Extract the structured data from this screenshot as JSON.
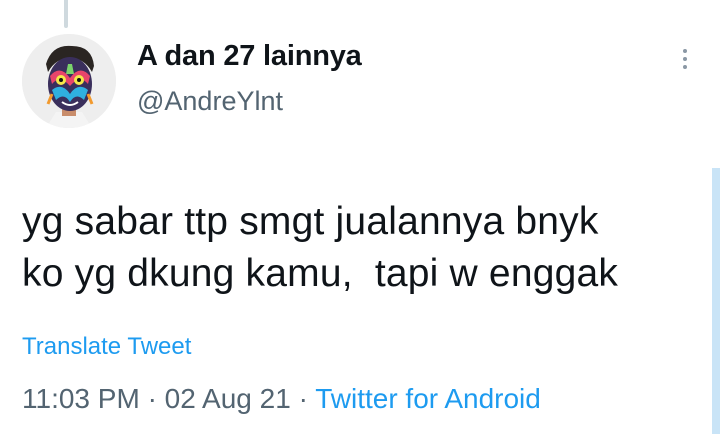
{
  "tweet": {
    "author": {
      "display_name": "A dan 27 lainnya",
      "handle": "@AndreYlnt",
      "avatar_icon": "profile-photo-painted-face"
    },
    "more_icon": "vertical-ellipsis-icon",
    "text_lines": [
      "yg sabar ttp smgt jualannya bnyk",
      "ko yg dkung kamu,  tapi w enggak"
    ],
    "translate_label": "Translate Tweet",
    "meta": {
      "time": "11:03 PM",
      "separator": "·",
      "date": "02 Aug 21",
      "source": "Twitter for Android"
    }
  },
  "colors": {
    "text_primary": "#0f1419",
    "text_secondary": "#536471",
    "accent_blue": "#1d9bf0",
    "thread_line": "#cfd9de"
  }
}
